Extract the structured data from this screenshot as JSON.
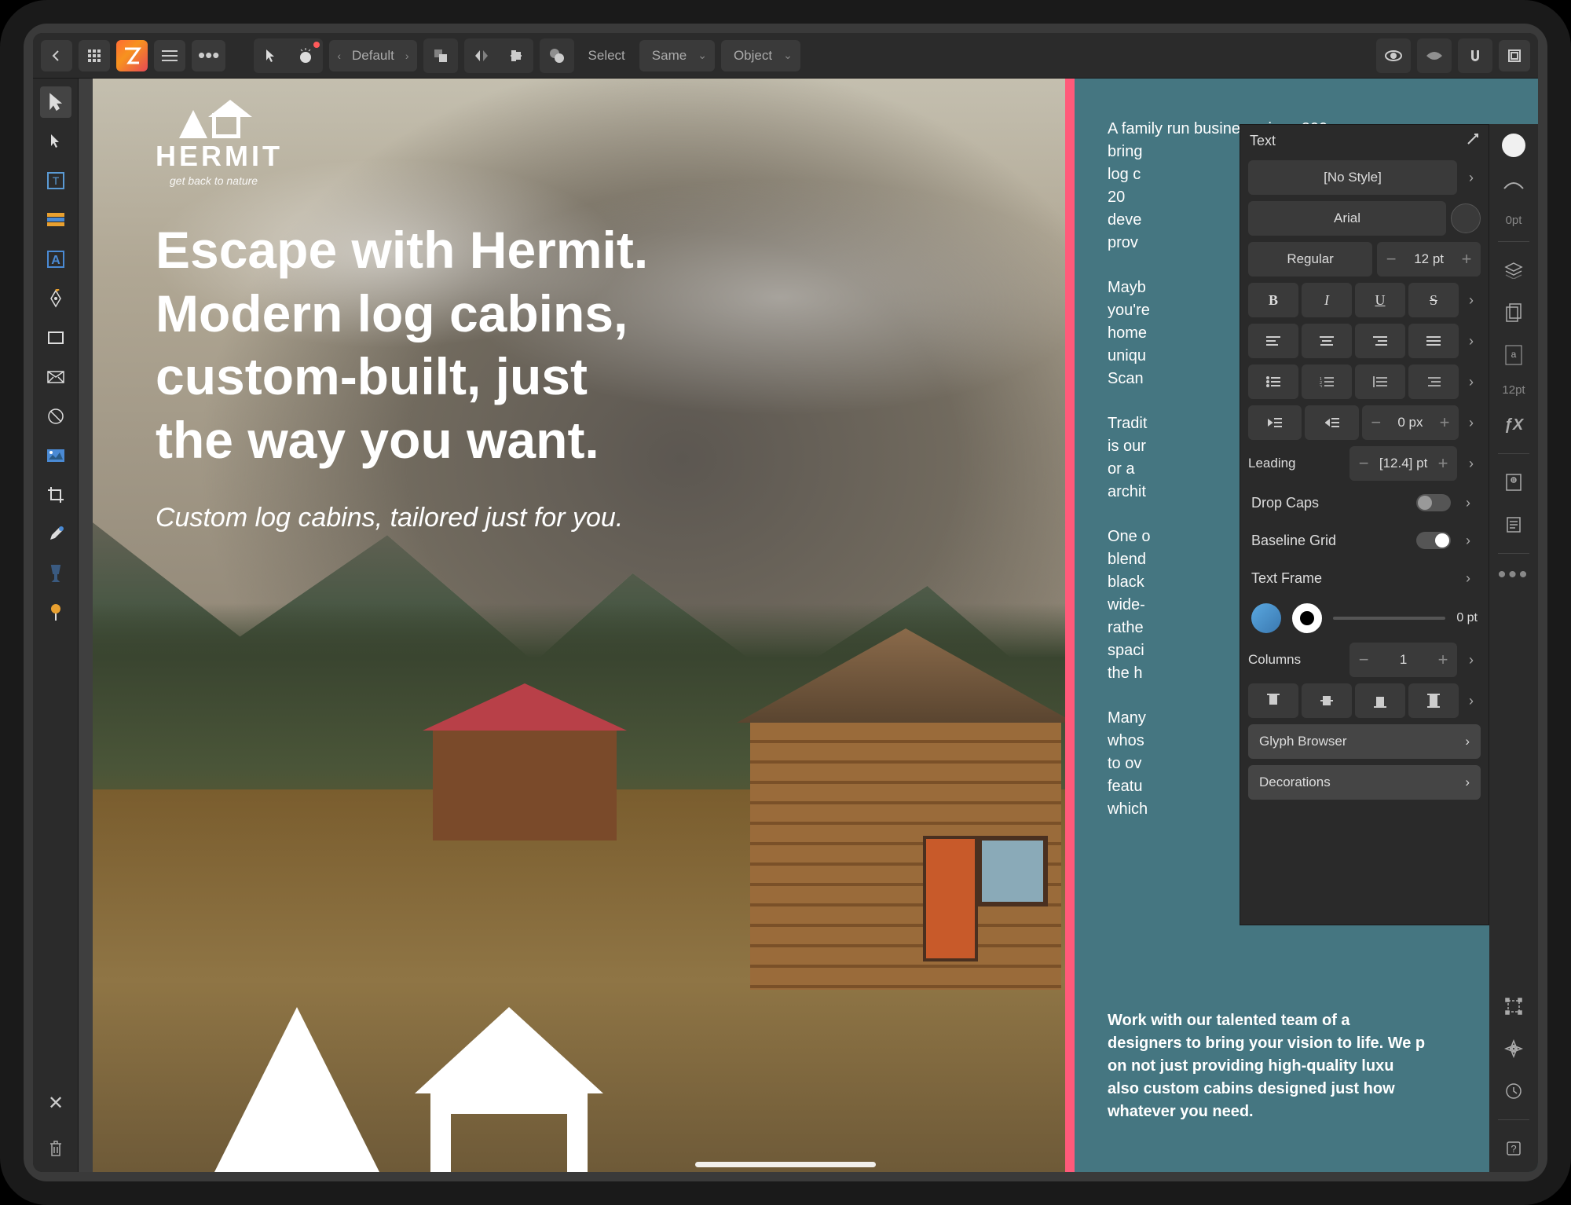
{
  "topbar": {
    "preset_label": "Default",
    "select_label": "Select",
    "same_label": "Same",
    "object_label": "Object"
  },
  "left_tools": [
    "move",
    "cursor",
    "text-frame",
    "table",
    "artistic-text",
    "pen",
    "rectangle",
    "crossed",
    "circle",
    "image",
    "crop",
    "eyedropper",
    "glass",
    "pin"
  ],
  "canvas": {
    "logo_name": "HERMIT",
    "logo_tagline": "get back to nature",
    "headline_l1": "Escape with Hermit.",
    "headline_l2": "Modern log cabins,",
    "headline_l3": "custom-built, just",
    "headline_l4": "the way you want.",
    "subhead": "Custom log cabins, tailored just for you.",
    "para1": "A family run business since 200",
    "para2": "bring",
    "para3": "log c",
    "para4": "20",
    "para5": "deve",
    "para6": "prov",
    "maybe1": "Mayb",
    "maybe2": "you're",
    "maybe3": "home",
    "maybe4": "uniqu",
    "maybe5": "Scan",
    "trad1": "Tradit",
    "trad2": "is our",
    "trad3": "or a",
    "trad4": "archit",
    "one1": "One o",
    "one2": "blend",
    "one3": "black",
    "one4": "wide-",
    "one5": "rathe",
    "one6": "spaci",
    "one7": "the h",
    "many1": "Many",
    "many2": "whos",
    "many3": "to ov",
    "many4": "featu",
    "many5": "which",
    "bold_block": "Work with our talented team of a\ndesigners to bring your vision to life. We p\non not just providing high-quality luxu\nalso custom cabins designed just how\nwhatever you need."
  },
  "text_panel": {
    "title": "Text",
    "style_label": "[No Style]",
    "font_family": "Arial",
    "font_weight": "Regular",
    "font_size": "12 pt",
    "bold": "B",
    "italic": "I",
    "underline": "U",
    "strike": "S",
    "outdent_value": "0 px",
    "leading_label": "Leading",
    "leading_value": "[12.4] pt",
    "dropcaps_label": "Drop Caps",
    "baseline_label": "Baseline Grid",
    "textframe_label": "Text Frame",
    "stroke_value": "0 pt",
    "columns_label": "Columns",
    "columns_value": "1",
    "glyph_label": "Glyph Browser",
    "decorations_label": "Decorations"
  },
  "right_strip": {
    "stroke_pt": "0pt",
    "fx": "ƒX",
    "char_pt": "12pt"
  }
}
